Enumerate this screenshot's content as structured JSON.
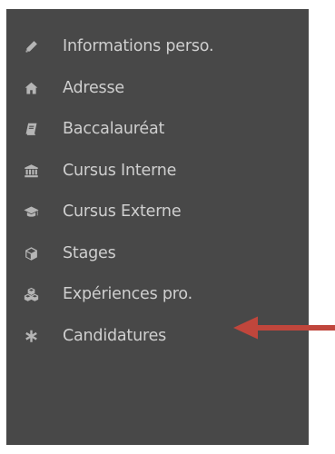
{
  "sidebar": {
    "background_color": "#484848",
    "label_color": "#cfcfcf",
    "icon_color": "#b5b5b5",
    "items": [
      {
        "label": "Informations perso.",
        "icon": "pencil-icon"
      },
      {
        "label": "Adresse",
        "icon": "home-icon"
      },
      {
        "label": "Baccalauréat",
        "icon": "book-icon"
      },
      {
        "label": "Cursus Interne",
        "icon": "institution-icon"
      },
      {
        "label": "Cursus Externe",
        "icon": "graduation-cap-icon"
      },
      {
        "label": "Stages",
        "icon": "cube-icon"
      },
      {
        "label": "Expériences pro.",
        "icon": "cubes-icon"
      },
      {
        "label": "Candidatures",
        "icon": "asterisk-icon"
      }
    ]
  },
  "annotation": {
    "icon": "arrow-left-icon",
    "color": "#c0463c",
    "points_to": "Candidatures"
  }
}
